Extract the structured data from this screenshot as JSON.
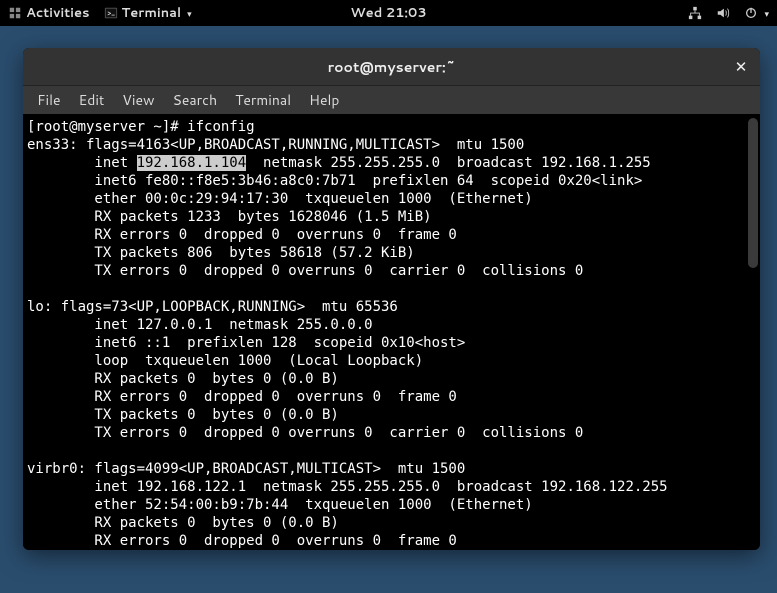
{
  "topbar": {
    "activities_label": "Activities",
    "app_label": "Terminal",
    "clock": "Wed 21:03"
  },
  "window": {
    "title": "root@myserver:~"
  },
  "menu": {
    "file": "File",
    "edit": "Edit",
    "view": "View",
    "search": "Search",
    "terminal": "Terminal",
    "help": "Help"
  },
  "terminal": {
    "prompt": "[root@myserver ~]# ",
    "command": "ifconfig",
    "highlight_ip": "192.168.1.104",
    "ens33_l1": "ens33: flags=4163<UP,BROADCAST,RUNNING,MULTICAST>  mtu 1500",
    "ens33_l2a": "        inet ",
    "ens33_l2b": "  netmask 255.255.255.0  broadcast 192.168.1.255",
    "ens33_l3": "        inet6 fe80::f8e5:3b46:a8c0:7b71  prefixlen 64  scopeid 0x20<link>",
    "ens33_l4": "        ether 00:0c:29:94:17:30  txqueuelen 1000  (Ethernet)",
    "ens33_l5": "        RX packets 1233  bytes 1628046 (1.5 MiB)",
    "ens33_l6": "        RX errors 0  dropped 0  overruns 0  frame 0",
    "ens33_l7": "        TX packets 806  bytes 58618 (57.2 KiB)",
    "ens33_l8": "        TX errors 0  dropped 0 overruns 0  carrier 0  collisions 0",
    "blank": "",
    "lo_l1": "lo: flags=73<UP,LOOPBACK,RUNNING>  mtu 65536",
    "lo_l2": "        inet 127.0.0.1  netmask 255.0.0.0",
    "lo_l3": "        inet6 ::1  prefixlen 128  scopeid 0x10<host>",
    "lo_l4": "        loop  txqueuelen 1000  (Local Loopback)",
    "lo_l5": "        RX packets 0  bytes 0 (0.0 B)",
    "lo_l6": "        RX errors 0  dropped 0  overruns 0  frame 0",
    "lo_l7": "        TX packets 0  bytes 0 (0.0 B)",
    "lo_l8": "        TX errors 0  dropped 0 overruns 0  carrier 0  collisions 0",
    "virbr0_l1": "virbr0: flags=4099<UP,BROADCAST,MULTICAST>  mtu 1500",
    "virbr0_l2": "        inet 192.168.122.1  netmask 255.255.255.0  broadcast 192.168.122.255",
    "virbr0_l3": "        ether 52:54:00:b9:7b:44  txqueuelen 1000  (Ethernet)",
    "virbr0_l4": "        RX packets 0  bytes 0 (0.0 B)",
    "virbr0_l5": "        RX errors 0  dropped 0  overruns 0  frame 0"
  }
}
